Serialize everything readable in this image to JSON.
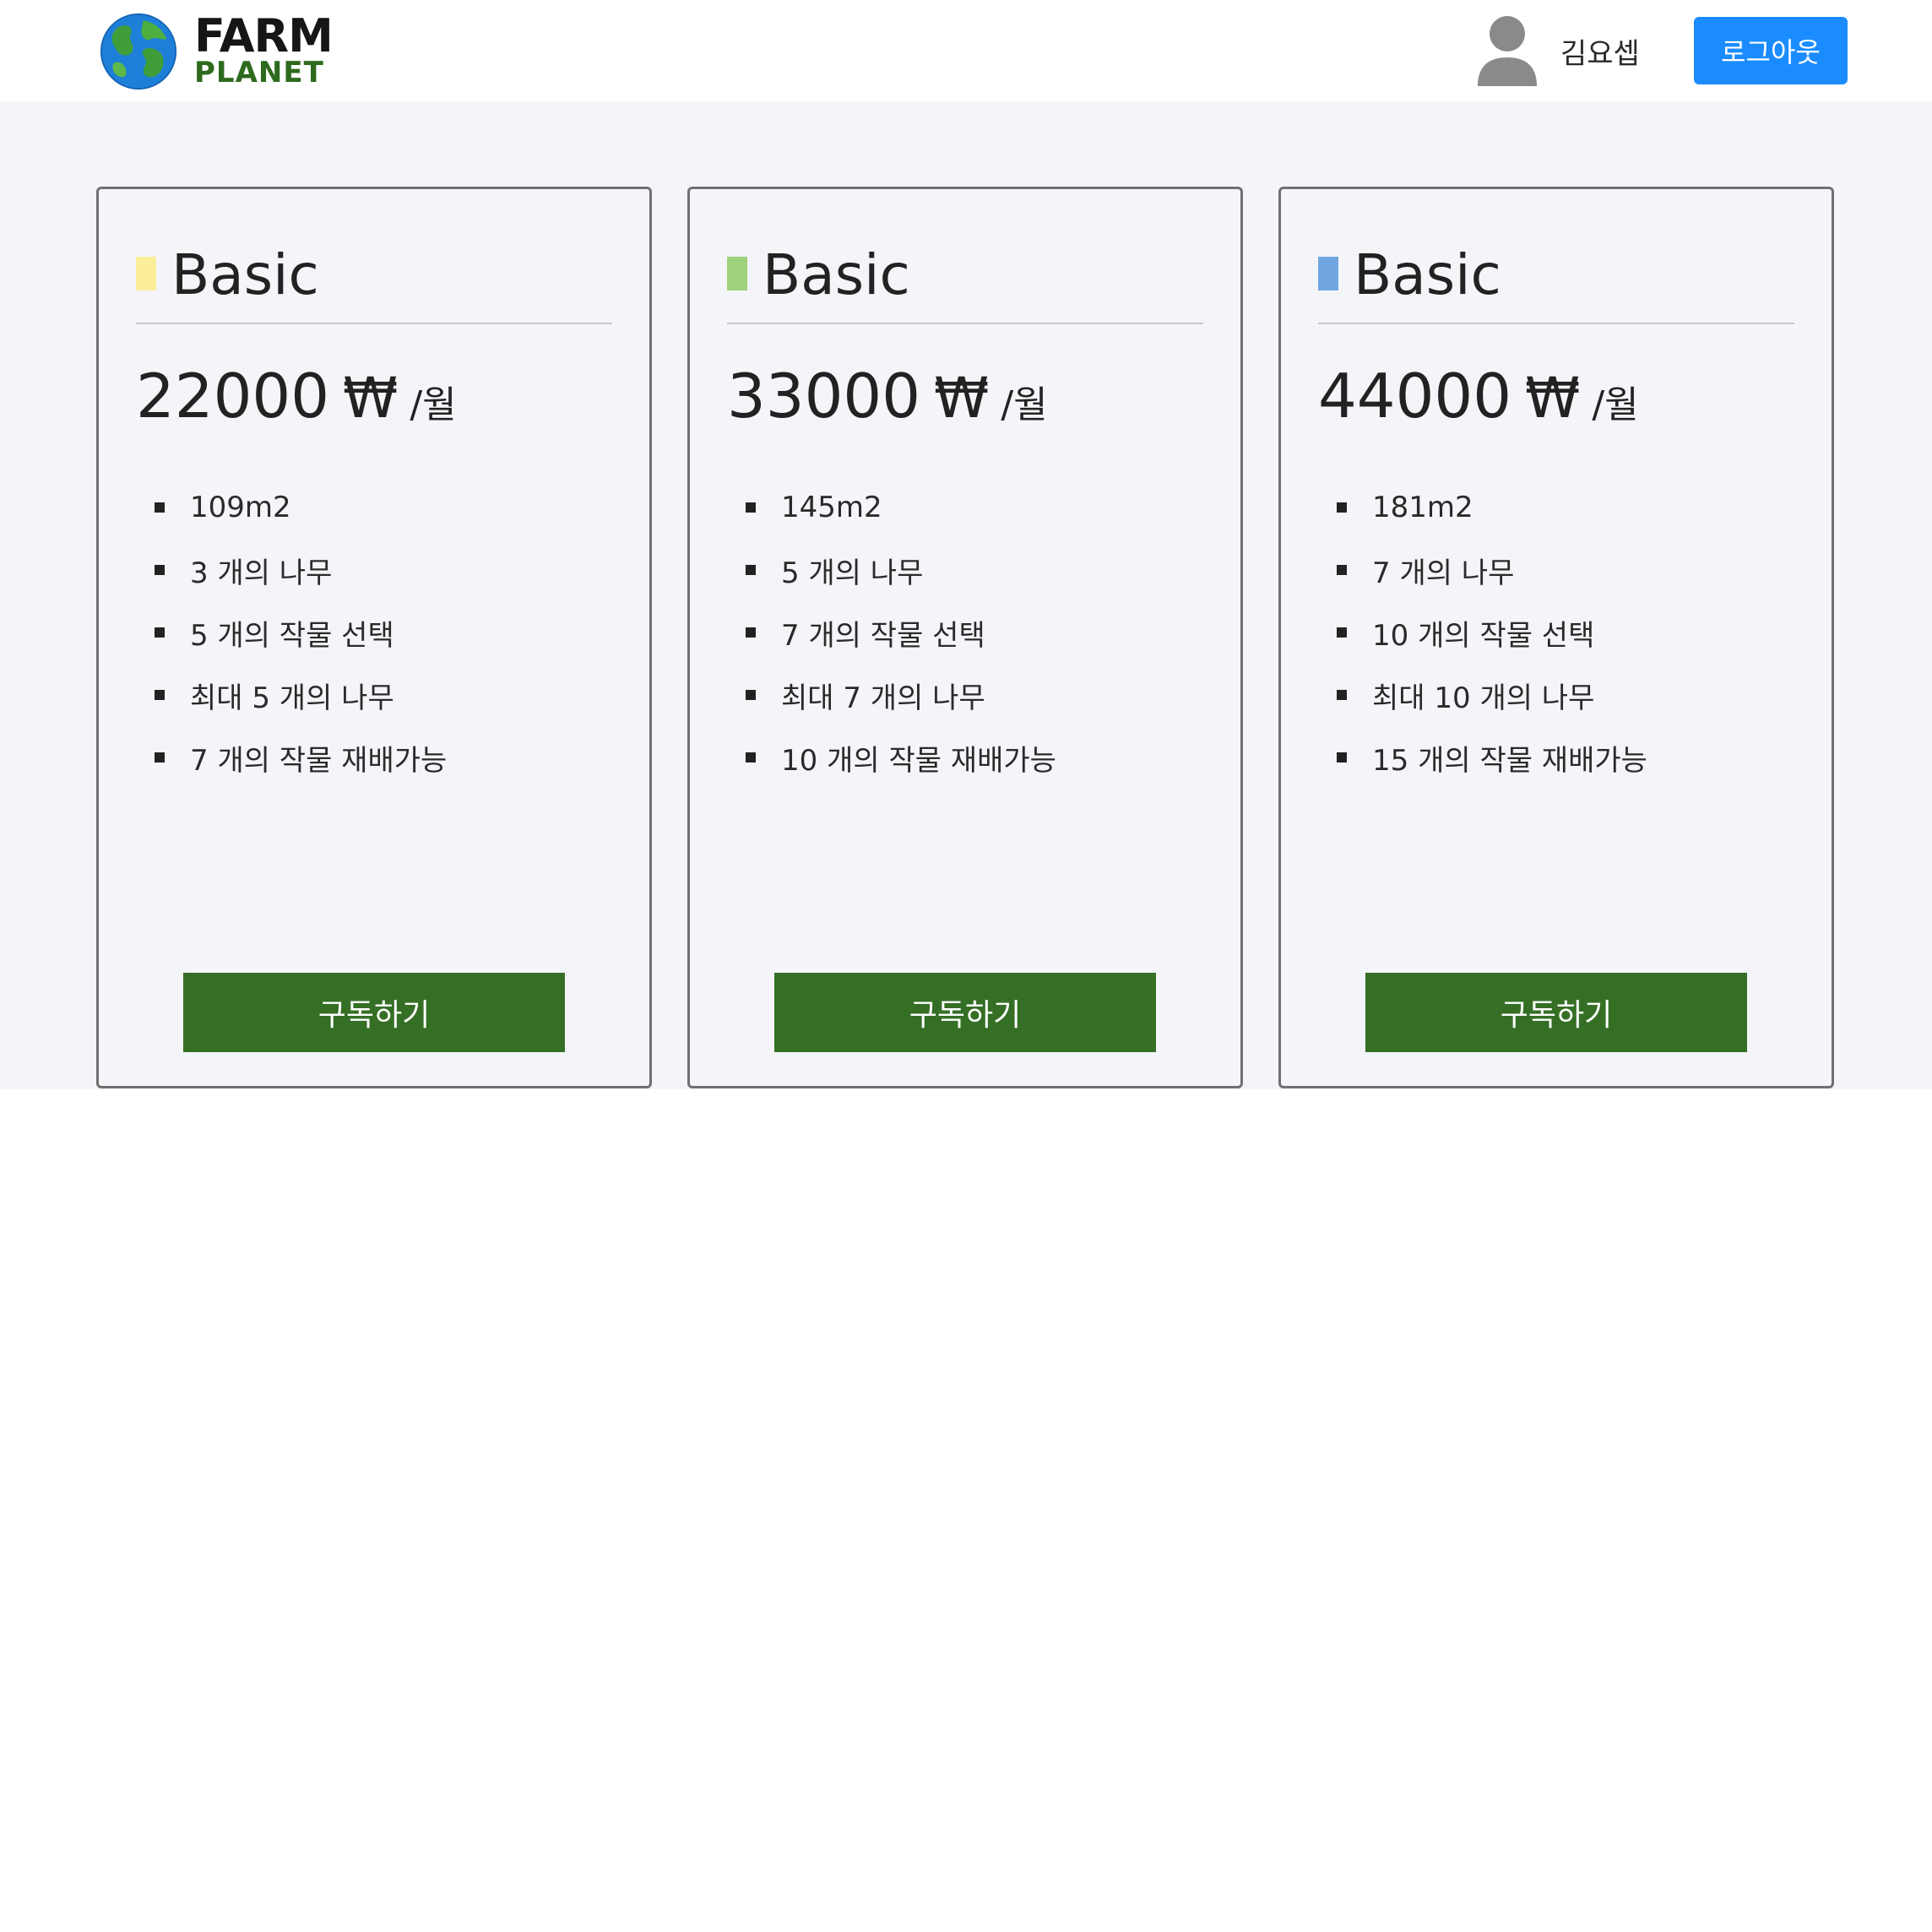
{
  "header": {
    "logo_line1": "FARM",
    "logo_line2": "PLANET",
    "user_name": "김요셉",
    "logout_label": "로그아웃"
  },
  "colors": {
    "primary_blue": "#1b8cff",
    "subscribe_green": "#356f25",
    "band_background": "#f4f5f9"
  },
  "plans": [
    {
      "name": "Basic",
      "marker_color": "#fbee9a",
      "price": "22000",
      "currency": "₩",
      "period": "/월",
      "features": [
        "109m2",
        "3 개의 나무",
        "5 개의 작물 선택",
        "최대 5 개의 나무",
        "7 개의 작물 재배가능"
      ],
      "button_label": "구독하기"
    },
    {
      "name": "Basic",
      "marker_color": "#9ed27d",
      "price": "33000",
      "currency": "₩",
      "period": "/월",
      "features": [
        "145m2",
        "5 개의 나무",
        "7 개의 작물 선택",
        "최대 7 개의 나무",
        "10 개의 작물 재배가능"
      ],
      "button_label": "구독하기"
    },
    {
      "name": "Basic",
      "marker_color": "#70a6e0",
      "price": "44000",
      "currency": "₩",
      "period": "/월",
      "features": [
        "181m2",
        "7 개의 나무",
        "10 개의 작물 선택",
        "최대 10 개의 나무",
        "15 개의 작물 재배가능"
      ],
      "button_label": "구독하기"
    }
  ]
}
